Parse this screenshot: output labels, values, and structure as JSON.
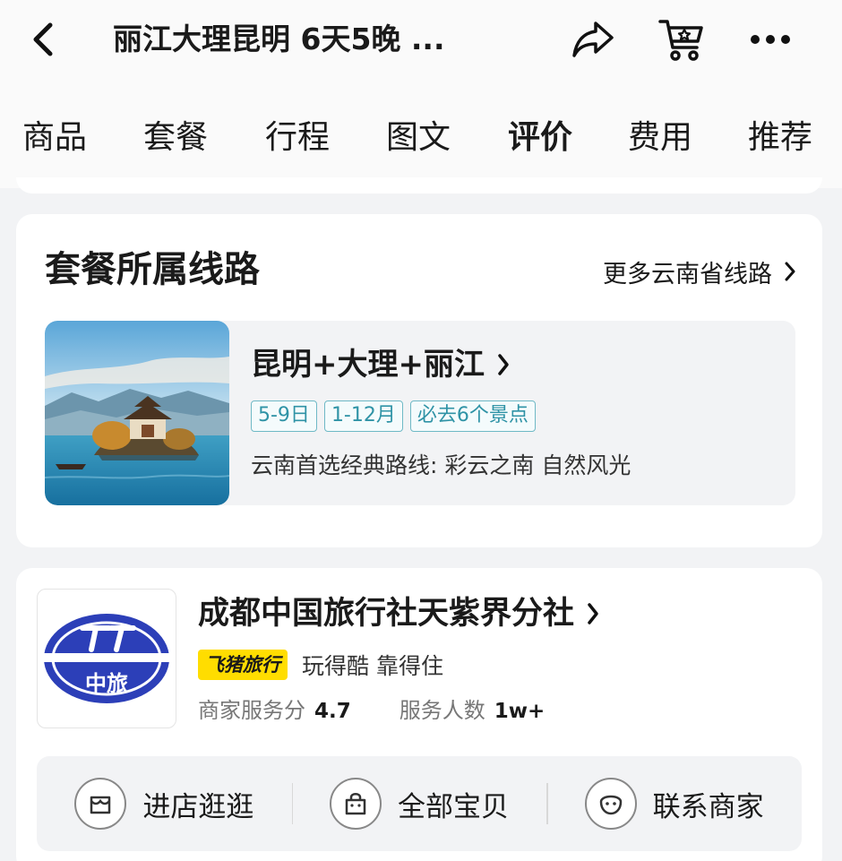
{
  "header": {
    "title": "丽江大理昆明 6天5晚 ...",
    "tabs": [
      {
        "label": "商品"
      },
      {
        "label": "套餐"
      },
      {
        "label": "行程"
      },
      {
        "label": "图文"
      },
      {
        "label": "评价",
        "active": true
      },
      {
        "label": "费用"
      },
      {
        "label": "推荐"
      }
    ]
  },
  "route_section": {
    "title": "套餐所属线路",
    "more_label": "更多云南省线路",
    "route": {
      "name": "昆明+大理+丽江",
      "tags": [
        "5-9日",
        "1-12月",
        "必去6个景点"
      ],
      "description": "云南首选经典路线: 彩云之南 自然风光"
    }
  },
  "shop": {
    "name": "成都中国旅行社天紫界分社",
    "logo_text": "中旅",
    "brand_badge": "飞猪旅行",
    "slogan": "玩得酷 靠得住",
    "service_score_label": "商家服务分",
    "service_score": "4.7",
    "served_label": "服务人数",
    "served_count": "1w+",
    "actions": [
      {
        "label": "进店逛逛",
        "icon": "store-icon"
      },
      {
        "label": "全部宝贝",
        "icon": "bag-icon"
      },
      {
        "label": "联系商家",
        "icon": "chat-icon"
      }
    ]
  },
  "colors": {
    "tag_border": "#6fb9c6",
    "tag_text": "#2f93a6",
    "brand_yellow": "#ffdd00",
    "logo_blue": "#2c3fb8"
  }
}
